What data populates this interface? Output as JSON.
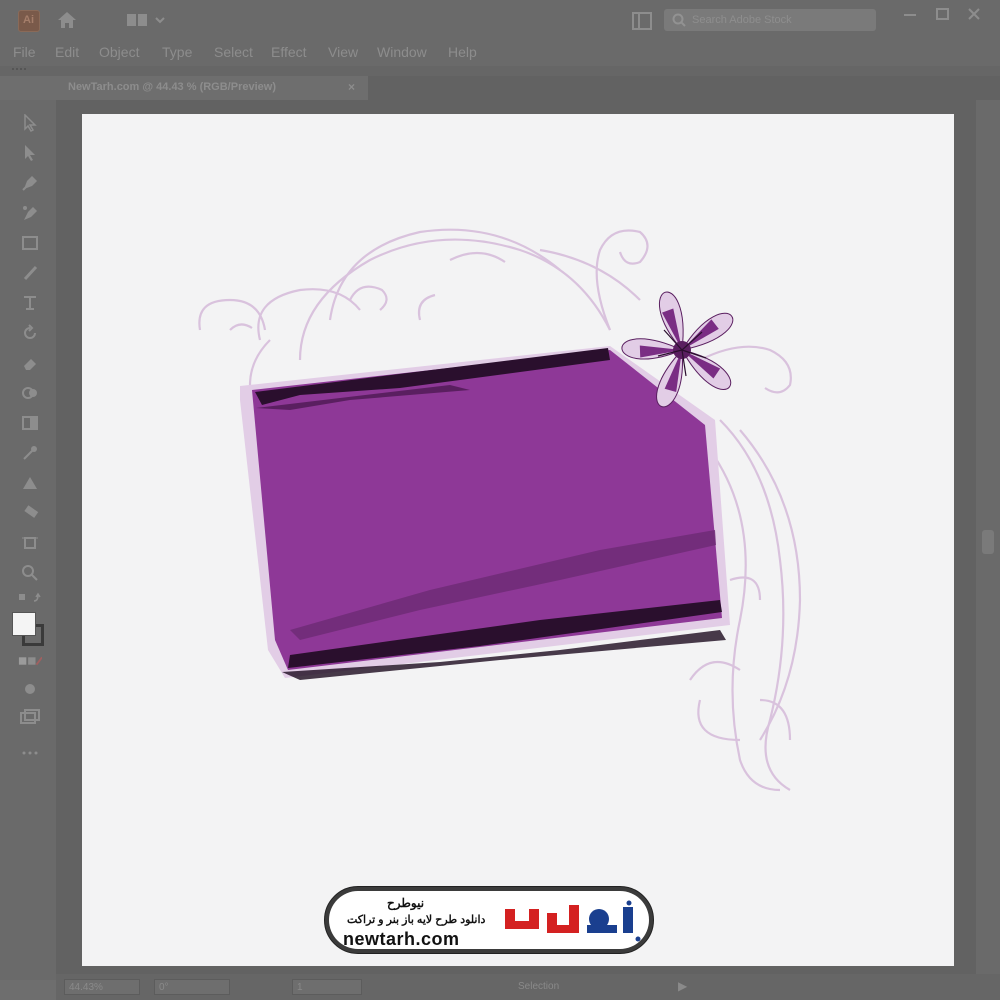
{
  "app": {
    "logo_text": "Ai",
    "search_placeholder": "Search Adobe Stock"
  },
  "menu": [
    "File",
    "Edit",
    "Object",
    "Type",
    "Select",
    "Effect",
    "View",
    "Window",
    "Help"
  ],
  "document_tab": {
    "title": "NewTarh.com @ 44.43 % (RGB/Preview)",
    "close": "×"
  },
  "status": {
    "zoom": "44.43%",
    "rotation": "0°",
    "artboard": "1",
    "mode": "Selection"
  },
  "watermark": {
    "title": "نیوطرح",
    "subtitle": "دانلود طرح لایه باز بنر و تراکت",
    "url": "newtarh.com",
    "logo_text": "نیوطرح"
  },
  "colors": {
    "frame_purple": "#8e3897",
    "frame_dark": "#5a1f60",
    "light_lilac": "#e2cde6",
    "swirl": "#d9c2dd",
    "flower_center": "#7a2d84"
  }
}
